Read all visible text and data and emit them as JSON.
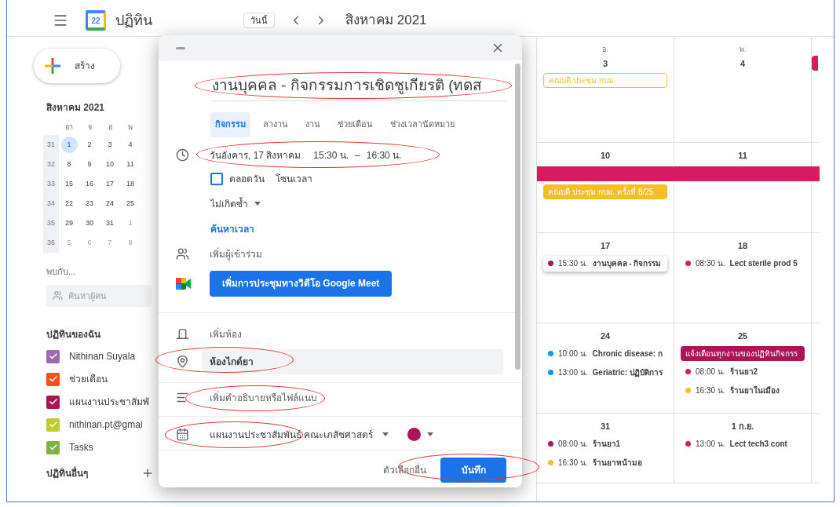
{
  "header": {
    "logo_day": "22",
    "app_title": "ปฏิทิน",
    "today": "วันนี้",
    "month": "สิงหาคม 2021"
  },
  "sidebar": {
    "create": "สร้าง",
    "mini_month": {
      "title": "สิงหาคม 2021",
      "weekdays": [
        "อา",
        "จ",
        "อ",
        "พ"
      ],
      "weeks": [
        {
          "week": "31",
          "days": [
            {
              "day": "1",
              "selected": true,
              "other_month": false
            },
            {
              "day": "2",
              "selected": false,
              "other_month": false
            },
            {
              "day": "3",
              "selected": false,
              "other_month": false
            },
            {
              "day": "4",
              "selected": false,
              "other_month": false
            }
          ]
        },
        {
          "week": "32",
          "days": [
            {
              "day": "8",
              "selected": false,
              "other_month": false
            },
            {
              "day": "9",
              "selected": false,
              "other_month": false
            },
            {
              "day": "10",
              "selected": false,
              "other_month": false
            },
            {
              "day": "11",
              "selected": false,
              "other_month": false
            }
          ]
        },
        {
          "week": "33",
          "days": [
            {
              "day": "15",
              "selected": false,
              "other_month": false
            },
            {
              "day": "16",
              "selected": false,
              "other_month": false
            },
            {
              "day": "17",
              "selected": false,
              "other_month": false
            },
            {
              "day": "18",
              "selected": false,
              "other_month": false
            }
          ]
        },
        {
          "week": "34",
          "days": [
            {
              "day": "22",
              "selected": false,
              "other_month": false
            },
            {
              "day": "23",
              "selected": false,
              "other_month": false
            },
            {
              "day": "24",
              "selected": false,
              "other_month": false
            },
            {
              "day": "25",
              "selected": false,
              "other_month": false
            }
          ]
        },
        {
          "week": "35",
          "days": [
            {
              "day": "29",
              "selected": false,
              "other_month": false
            },
            {
              "day": "30",
              "selected": false,
              "other_month": false
            },
            {
              "day": "31",
              "selected": false,
              "other_month": false
            },
            {
              "day": "1",
              "selected": false,
              "other_month": true
            }
          ]
        },
        {
          "week": "36",
          "days": [
            {
              "day": "5",
              "selected": false,
              "other_month": true
            },
            {
              "day": "6",
              "selected": false,
              "other_month": true
            },
            {
              "day": "7",
              "selected": false,
              "other_month": true
            },
            {
              "day": "8",
              "selected": false,
              "other_month": true
            }
          ]
        }
      ]
    },
    "meet_with": "พบกับ...",
    "search": {
      "placeholder": "ค้นหาผู้คน"
    },
    "my_calendars": {
      "title": "ปฏิทินของฉัน",
      "items": [
        {
          "name": "Nithinan Suyala",
          "color": "#9e69af",
          "checked": true
        },
        {
          "name": "ช่วยเตือน",
          "color": "#f4511e",
          "checked": true
        },
        {
          "name": "แผนงานประชาสัมพั",
          "color": "#ad1457",
          "checked": true
        },
        {
          "name": "nithinan.pt@gmai",
          "color": "#c0ca33",
          "checked": true
        },
        {
          "name": "Tasks",
          "color": "#7cb342",
          "checked": true
        }
      ]
    },
    "other_calendars": {
      "title": "ปฏิทินอื่นๆ"
    }
  },
  "calendar": {
    "weekdays": [
      "อ.",
      "พ."
    ],
    "weeks": [
      {
        "days": [
          {
            "date": "3",
            "events": [
              {
                "kind": "outlined",
                "title": "คณบดี ประชุม กบม.",
                "color": "#f6bf26"
              }
            ]
          },
          {
            "date": "4"
          },
          {
            "events": [
              {
                "kind": "stub",
                "color": "#d81b60"
              }
            ]
          }
        ]
      },
      {
        "bar": {
          "color": "#d81b60"
        },
        "days": [
          {
            "date": "10",
            "events": [
              {
                "kind": "chip",
                "title": "คณบดี ประชุม กบม. ครั้งที่ 8/25",
                "color": "#f6bf26"
              }
            ]
          },
          {
            "date": "11"
          }
        ]
      },
      {
        "days": [
          {
            "date": "17",
            "events": [
              {
                "kind": "draft",
                "time": "15:30 น.",
                "title": "งานบุคคล - กิจกรรม",
                "color": "#ad1457"
              }
            ]
          },
          {
            "date": "18",
            "events": [
              {
                "kind": "timed",
                "time": "08:30 น.",
                "title": "Lect sterile prod 5",
                "color": "#d81b60"
              }
            ]
          }
        ]
      },
      {
        "days": [
          {
            "date": "24",
            "events": [
              {
                "kind": "timed",
                "time": "10:00 น.",
                "title": "Chronic disease: ก",
                "color": "#039be5"
              },
              {
                "kind": "timed",
                "time": "13:00 น.",
                "title": "Geriatric: ปฏิบัติการ",
                "color": "#039be5"
              }
            ]
          },
          {
            "date": "25",
            "events": [
              {
                "kind": "chip",
                "title": "แจ้งเตือนทุกงานของปฏิทินกิจกรร",
                "color": "#ad1457"
              },
              {
                "kind": "timed",
                "time": "08:00 น.",
                "title": "ร้านยา2",
                "color": "#d81b60"
              },
              {
                "kind": "timed",
                "time": "16:30 น.",
                "title": "ร้านยาในเมือง",
                "color": "#f6bf26"
              }
            ]
          }
        ]
      },
      {
        "days": [
          {
            "date": "31",
            "events": [
              {
                "kind": "timed",
                "time": "08:00 น.",
                "title": "ร้านยา1",
                "color": "#ad1457"
              },
              {
                "kind": "timed",
                "time": "16:30 น.",
                "title": "ร้านยาหน้ามอ",
                "color": "#f6bf26"
              }
            ]
          },
          {
            "date": "1 ก.ย.",
            "events": [
              {
                "kind": "timed",
                "time": "13:00 น.",
                "title": "Lect tech3 cont",
                "color": "#d81b60"
              }
            ]
          }
        ]
      }
    ]
  },
  "dialog": {
    "title": "งานบุคคล - กิจกรรมการเชิดชูเกียรติ (ทดส",
    "tabs": [
      {
        "label": "กิจกรรม",
        "selected": true
      },
      {
        "label": "ลางาน",
        "selected": false
      },
      {
        "label": "งาน",
        "selected": false
      },
      {
        "label": "ช่วยเตือน",
        "selected": false
      },
      {
        "label": "ช่วงเวลานัดหมาย",
        "selected": false
      }
    ],
    "date": "วันอังคาร, 17 สิงหาคม",
    "start": "15:30 น.",
    "dash": "–",
    "end": "16:30 น.",
    "all_day": {
      "label": "ตลอดวัน",
      "checked": false
    },
    "timezone": "โซนเวลา",
    "repeat": "ไม่เกิดซ้ำ",
    "find_time": "ค้นหาเวลา",
    "guests": "เพิ่มผู้เข้าร่วม",
    "meet_button": "เพิ่มการประชุมทางวิดีโอ Google Meet",
    "room": "เพิ่มห้อง",
    "location": {
      "value": "ห้องไกด์ยา"
    },
    "description": {
      "placeholder": "เพิ่มคำอธิบายหรือไฟล์แนบ"
    },
    "calendar": {
      "name": "แผนงานประชาสัมพันธ์ คณะเภสัชศาสตร์",
      "color": "#ad1457"
    },
    "more_options": "ตัวเลือกอื่น",
    "save": "บันทึก"
  }
}
